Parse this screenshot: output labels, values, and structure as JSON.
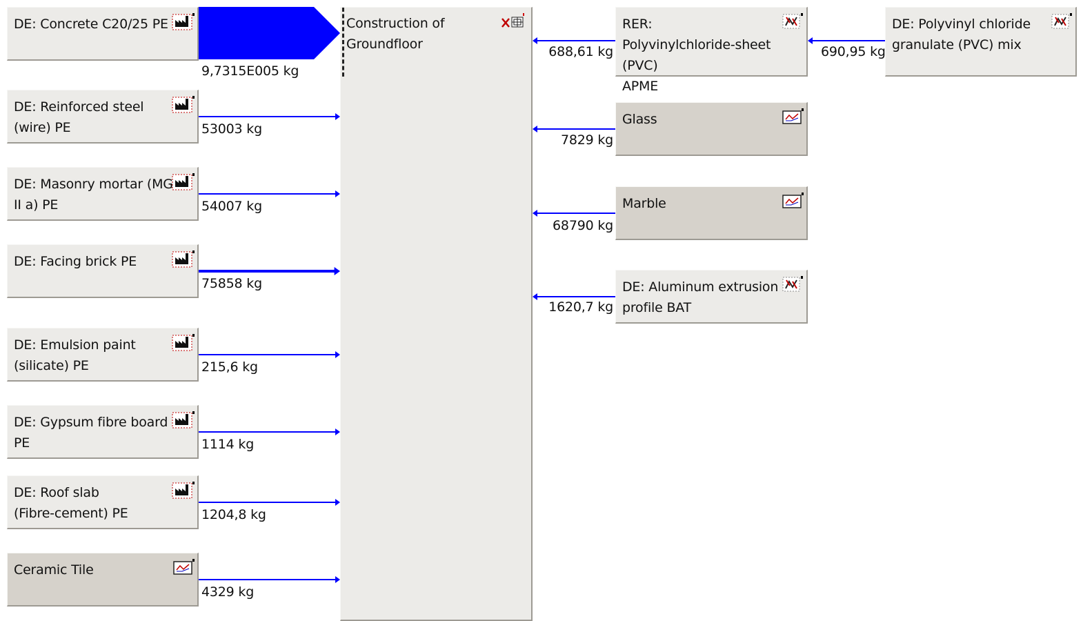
{
  "center_process": {
    "label": "Construction of\nGroundfloor",
    "icon": "process-plan-icon"
  },
  "inputs": [
    {
      "label": "DE: Concrete C20/25 PE",
      "flow": "9,7315E005 kg",
      "icon": "factory-icon",
      "style": "light"
    },
    {
      "label": "DE: Reinforced steel\n(wire) PE",
      "flow": "53003 kg",
      "icon": "factory-icon",
      "style": "light"
    },
    {
      "label": "DE: Masonry mortar (MG\nII a) PE",
      "flow": "54007 kg",
      "icon": "factory-icon",
      "style": "light"
    },
    {
      "label": "DE: Facing brick PE",
      "flow": "75858 kg",
      "icon": "factory-icon",
      "style": "light"
    },
    {
      "label": "DE: Emulsion paint\n(silicate) PE",
      "flow": "215,6 kg",
      "icon": "factory-icon",
      "style": "light"
    },
    {
      "label": "DE: Gypsum fibre board\nPE",
      "flow": "1114 kg",
      "icon": "factory-icon",
      "style": "light"
    },
    {
      "label": "DE: Roof slab\n(Fibre-cement) PE",
      "flow": "1204,8 kg",
      "icon": "factory-icon",
      "style": "light"
    },
    {
      "label": "Ceramic Tile",
      "flow": "4329 kg",
      "icon": "chart-icon",
      "style": "dark"
    }
  ],
  "right_processes": [
    {
      "label": "RER:\nPolyvinylchloride-sheet (PVC)\nAPME",
      "flow": "688,61 kg",
      "icon": "aggregated-process-icon",
      "style": "light"
    },
    {
      "label": "Glass",
      "flow": "7829 kg",
      "icon": "chart-icon",
      "style": "dark"
    },
    {
      "label": "Marble",
      "flow": "68790 kg",
      "icon": "chart-icon",
      "style": "dark"
    },
    {
      "label": "DE: Aluminum extrusion\nprofile BAT",
      "flow": "1620,7 kg",
      "icon": "aggregated-process-icon",
      "style": "light"
    }
  ],
  "far_right_process": {
    "label": "DE: Polyvinyl chloride\ngranulate (PVC) mix",
    "flow": "690,95 kg",
    "icon": "aggregated-process-icon"
  },
  "colors": {
    "flow": "#0000ff",
    "box_light": "#ecebe8",
    "box_dark": "#d6d2cb",
    "marker_red": "#d00000"
  }
}
